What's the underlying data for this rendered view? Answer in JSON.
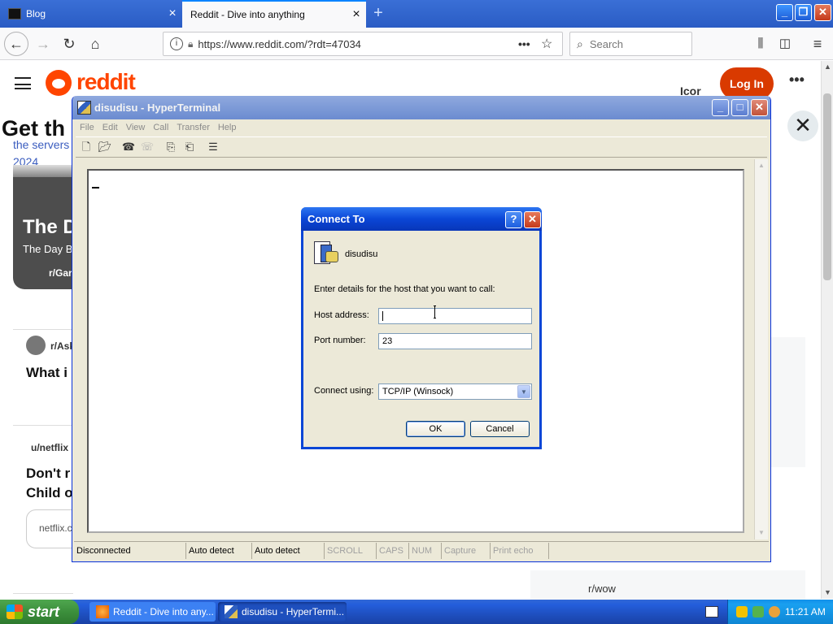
{
  "browser": {
    "tabs": [
      {
        "label": "Blog",
        "active": false
      },
      {
        "label": "Reddit - Dive into anything",
        "active": true
      }
    ],
    "url": "https://www.reddit.com/?rdt=47034",
    "search_placeholder": "Search"
  },
  "reddit": {
    "wordmark": "reddit",
    "login_label": "Log In",
    "icon_text": "Icor",
    "get_the": "Get th",
    "gray_small": "...",
    "blue_line1": "the servers",
    "blue_line2": "2024",
    "card_title": "The D",
    "card_sub": "The Day B",
    "card_sub2": "r/Gar",
    "post1_sub": "r/Ask",
    "post1_title": "What i",
    "post2_sub": "u/netflix",
    "post2_title_line1": "Don't r",
    "post2_title_line2": "Child o",
    "netflix_pill": "netflix.c",
    "side_label": "r/wow"
  },
  "hyperterminal": {
    "title": "disudisu - HyperTerminal",
    "menu": [
      "File",
      "Edit",
      "View",
      "Call",
      "Transfer",
      "Help"
    ],
    "status": {
      "connection": "Disconnected",
      "detect1": "Auto detect",
      "detect2": "Auto detect",
      "scroll": "SCROLL",
      "caps": "CAPS",
      "num": "NUM",
      "capture": "Capture",
      "print_echo": "Print echo"
    }
  },
  "dialog": {
    "title": "Connect To",
    "connection_name": "disudisu",
    "instruction": "Enter details for the host that you want to call:",
    "host_label": "Host address:",
    "host_value": "",
    "port_label": "Port number:",
    "port_value": "23",
    "connect_using_label": "Connect using:",
    "connect_using_value": "TCP/IP (Winsock)",
    "ok_label": "OK",
    "cancel_label": "Cancel"
  },
  "taskbar": {
    "start_label": "start",
    "tasks": [
      {
        "label": "Reddit - Dive into any..."
      },
      {
        "label": "disudisu - HyperTermi..."
      }
    ],
    "clock": "11:21 AM"
  }
}
